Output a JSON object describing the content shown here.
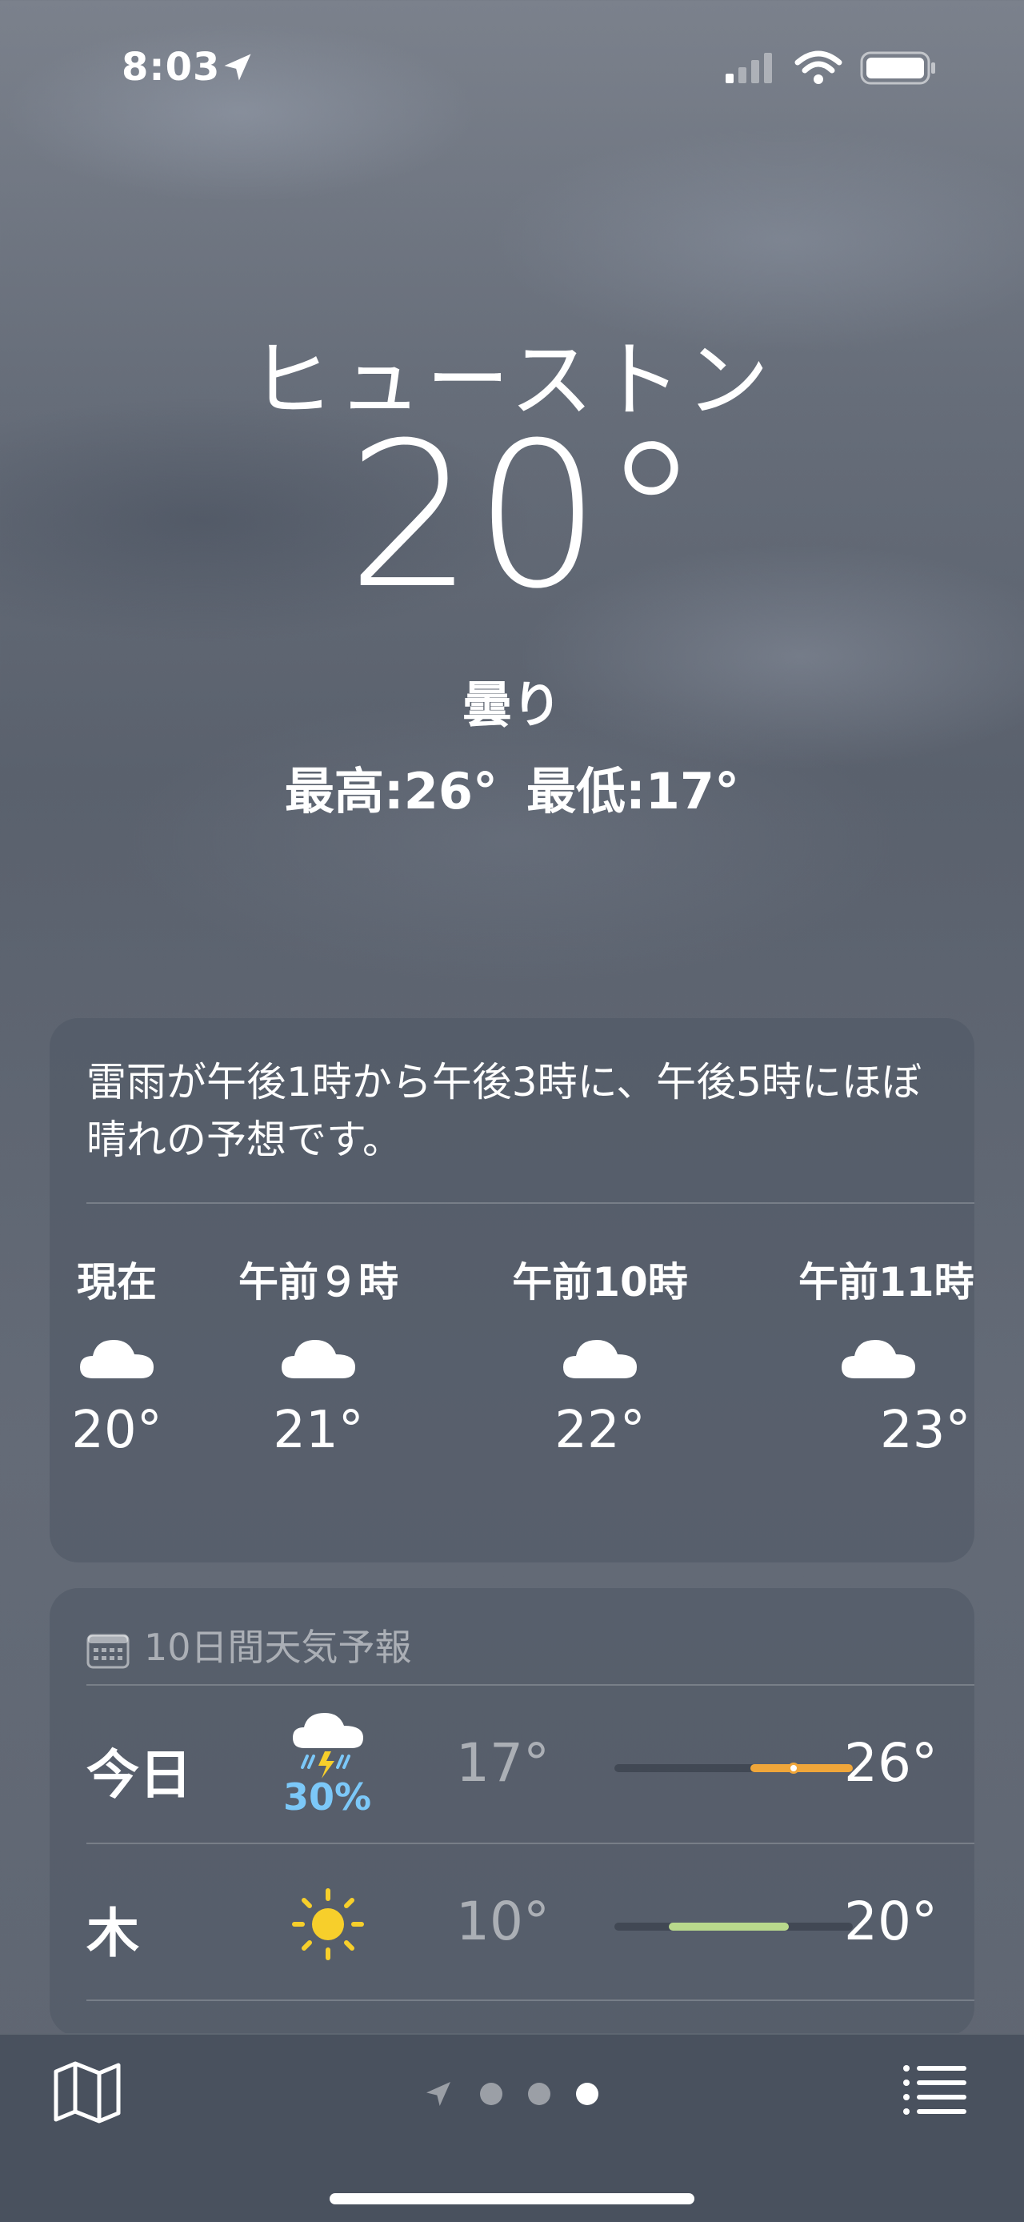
{
  "status_bar": {
    "time": "8:03"
  },
  "header": {
    "city": "ヒューストン",
    "temperature": "20°",
    "condition": "曇り",
    "high": "最高:26°",
    "low": "最低:17°"
  },
  "hourly": {
    "summary": "雷雨が午後1時から午後3時に、午後5時にほぼ晴れの予想です。",
    "items": [
      {
        "label": "現在",
        "icon": "cloud-icon",
        "temp": "20°"
      },
      {
        "label": "午前９時",
        "icon": "cloud-icon",
        "temp": "21°"
      },
      {
        "label": "午前10時",
        "icon": "cloud-icon",
        "temp": "22°"
      },
      {
        "label": "午前11時",
        "icon": "cloud-icon",
        "temp": "23°"
      }
    ]
  },
  "forecast": {
    "title": "10日間天気予報",
    "days": [
      {
        "day": "今日",
        "icon": "thunderstorm-icon",
        "precip": "30%",
        "low": "17°",
        "high": "26°",
        "bar_color": "#f0a63a",
        "current_marker": true
      },
      {
        "day": "木",
        "icon": "sun-icon",
        "precip": "",
        "low": "10°",
        "high": "20°",
        "bar_color": "#b9d98c",
        "current_marker": false
      }
    ]
  },
  "pager": {
    "pages": 3,
    "active": 2
  },
  "colors": {
    "precip": "#7cc8f8",
    "sun": "#f7cf2b",
    "bar_warm": "#f0a63a"
  }
}
